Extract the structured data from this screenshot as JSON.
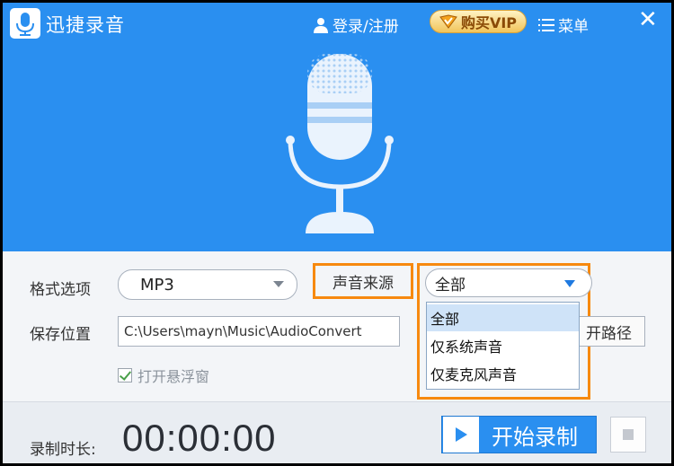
{
  "app": {
    "title": "迅捷录音"
  },
  "header": {
    "login_label": "登录/注册",
    "vip_label": "购买VIP",
    "menu_label": "菜单",
    "close_glyph": "✕"
  },
  "settings": {
    "format_label": "格式选项",
    "format_value": "MP3",
    "source_label": "声音来源",
    "source_value": "全部",
    "source_options": [
      "全部",
      "仅系统声音",
      "仅麦克风声音"
    ],
    "save_label": "保存位置",
    "save_path": "C:\\Users\\mayn\\Music\\AudioConvert",
    "open_path_label": "开路径",
    "float_window_label": "打开悬浮窗",
    "float_window_checked": true
  },
  "footer": {
    "duration_label": "录制时长:",
    "timer": "00:00:00",
    "start_label": "开始录制"
  },
  "colors": {
    "primary": "#2a8ff0",
    "highlight": "#f7890f",
    "selected_option": "#cfe3f8"
  }
}
